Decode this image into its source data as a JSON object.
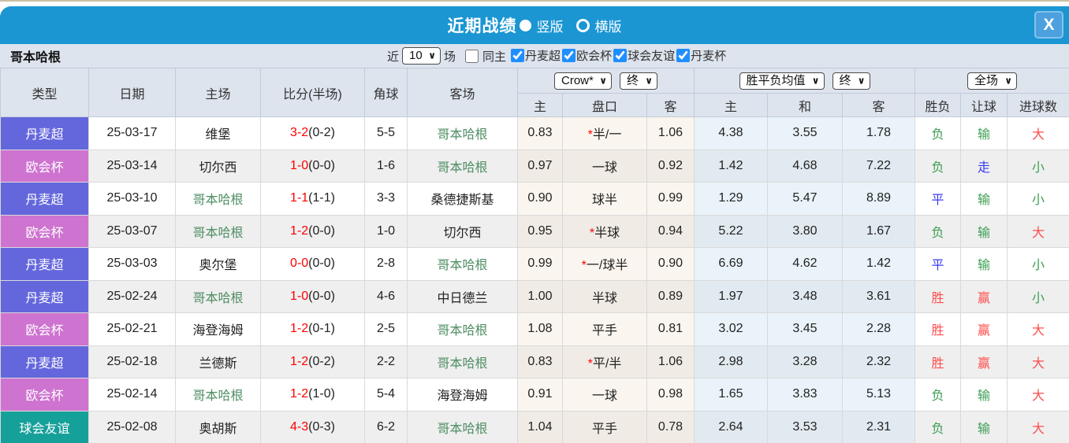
{
  "titlebar": {
    "title": "近期战绩",
    "layout_options": [
      {
        "label": "竖版",
        "selected": true
      },
      {
        "label": "横版",
        "selected": false
      }
    ],
    "close_label": "X"
  },
  "filter": {
    "team": "哥本哈根",
    "recent_label": "近",
    "recent_value": "10",
    "matches_label": "场",
    "same_home_label": "同主",
    "same_home_checked": false,
    "leagues": [
      "丹麦超",
      "欧会杯",
      "球会友谊",
      "丹麦杯"
    ]
  },
  "table": {
    "headers": {
      "main": [
        "类型",
        "日期",
        "主场",
        "比分(半场)",
        "角球",
        "客场"
      ],
      "sub": [
        "主",
        "盘口",
        "客",
        "主",
        "和",
        "客",
        "胜负",
        "让球",
        "进球数"
      ]
    },
    "selects": {
      "bookmaker": "Crow*",
      "bookmaker_period": "终",
      "avg": "胜平负均值",
      "avg_period": "终",
      "scope": "全场"
    },
    "rows": [
      {
        "league": "丹麦超",
        "date": "25-03-17",
        "home": "维堡",
        "home_self": false,
        "score_ft": "3-2",
        "score_ht": "0-2",
        "corner": "5-5",
        "away": "哥本哈根",
        "away_self": true,
        "crown_home": "0.83",
        "handicap": "半/一",
        "handicap_star": true,
        "crown_away": "1.06",
        "avg_win": "4.38",
        "avg_draw": "3.55",
        "avg_lose": "1.78",
        "wdl": {
          "text": "负",
          "color": "green"
        },
        "hcp": {
          "text": "输",
          "color": "green"
        },
        "goals": {
          "text": "大",
          "color": "red"
        }
      },
      {
        "league": "欧会杯",
        "date": "25-03-14",
        "home": "切尔西",
        "home_self": false,
        "score_ft": "1-0",
        "score_ht": "0-0",
        "corner": "1-6",
        "away": "哥本哈根",
        "away_self": true,
        "crown_home": "0.97",
        "handicap": "一球",
        "handicap_star": false,
        "crown_away": "0.92",
        "avg_win": "1.42",
        "avg_draw": "4.68",
        "avg_lose": "7.22",
        "wdl": {
          "text": "负",
          "color": "green"
        },
        "hcp": {
          "text": "走",
          "color": "blue"
        },
        "goals": {
          "text": "小",
          "color": "green"
        }
      },
      {
        "league": "丹麦超",
        "date": "25-03-10",
        "home": "哥本哈根",
        "home_self": true,
        "score_ft": "1-1",
        "score_ht": "1-1",
        "corner": "3-3",
        "away": "桑德捷斯基",
        "away_self": false,
        "crown_home": "0.90",
        "handicap": "球半",
        "handicap_star": false,
        "crown_away": "0.99",
        "avg_win": "1.29",
        "avg_draw": "5.47",
        "avg_lose": "8.89",
        "wdl": {
          "text": "平",
          "color": "blue"
        },
        "hcp": {
          "text": "输",
          "color": "green"
        },
        "goals": {
          "text": "小",
          "color": "green"
        }
      },
      {
        "league": "欧会杯",
        "date": "25-03-07",
        "home": "哥本哈根",
        "home_self": true,
        "score_ft": "1-2",
        "score_ht": "0-0",
        "corner": "1-0",
        "away": "切尔西",
        "away_self": false,
        "crown_home": "0.95",
        "handicap": "半球",
        "handicap_star": true,
        "crown_away": "0.94",
        "avg_win": "5.22",
        "avg_draw": "3.80",
        "avg_lose": "1.67",
        "wdl": {
          "text": "负",
          "color": "green"
        },
        "hcp": {
          "text": "输",
          "color": "green"
        },
        "goals": {
          "text": "大",
          "color": "red"
        }
      },
      {
        "league": "丹麦超",
        "date": "25-03-03",
        "home": "奥尔堡",
        "home_self": false,
        "score_ft": "0-0",
        "score_ht": "0-0",
        "corner": "2-8",
        "away": "哥本哈根",
        "away_self": true,
        "crown_home": "0.99",
        "handicap": "一/球半",
        "handicap_star": true,
        "crown_away": "0.90",
        "avg_win": "6.69",
        "avg_draw": "4.62",
        "avg_lose": "1.42",
        "wdl": {
          "text": "平",
          "color": "blue"
        },
        "hcp": {
          "text": "输",
          "color": "green"
        },
        "goals": {
          "text": "小",
          "color": "green"
        }
      },
      {
        "league": "丹麦超",
        "date": "25-02-24",
        "home": "哥本哈根",
        "home_self": true,
        "score_ft": "1-0",
        "score_ht": "0-0",
        "corner": "4-6",
        "away": "中日德兰",
        "away_self": false,
        "crown_home": "1.00",
        "handicap": "半球",
        "handicap_star": false,
        "crown_away": "0.89",
        "avg_win": "1.97",
        "avg_draw": "3.48",
        "avg_lose": "3.61",
        "wdl": {
          "text": "胜",
          "color": "red"
        },
        "hcp": {
          "text": "赢",
          "color": "red"
        },
        "goals": {
          "text": "小",
          "color": "green"
        }
      },
      {
        "league": "欧会杯",
        "date": "25-02-21",
        "home": "海登海姆",
        "home_self": false,
        "score_ft": "1-2",
        "score_ht": "0-1",
        "corner": "2-5",
        "away": "哥本哈根",
        "away_self": true,
        "crown_home": "1.08",
        "handicap": "平手",
        "handicap_star": false,
        "crown_away": "0.81",
        "avg_win": "3.02",
        "avg_draw": "3.45",
        "avg_lose": "2.28",
        "wdl": {
          "text": "胜",
          "color": "red"
        },
        "hcp": {
          "text": "赢",
          "color": "red"
        },
        "goals": {
          "text": "大",
          "color": "red"
        }
      },
      {
        "league": "丹麦超",
        "date": "25-02-18",
        "home": "兰德斯",
        "home_self": false,
        "score_ft": "1-2",
        "score_ht": "0-2",
        "corner": "2-2",
        "away": "哥本哈根",
        "away_self": true,
        "crown_home": "0.83",
        "handicap": "平/半",
        "handicap_star": true,
        "crown_away": "1.06",
        "avg_win": "2.98",
        "avg_draw": "3.28",
        "avg_lose": "2.32",
        "wdl": {
          "text": "胜",
          "color": "red"
        },
        "hcp": {
          "text": "赢",
          "color": "red"
        },
        "goals": {
          "text": "大",
          "color": "red"
        }
      },
      {
        "league": "欧会杯",
        "date": "25-02-14",
        "home": "哥本哈根",
        "home_self": true,
        "score_ft": "1-2",
        "score_ht": "1-0",
        "corner": "5-4",
        "away": "海登海姆",
        "away_self": false,
        "crown_home": "0.91",
        "handicap": "一球",
        "handicap_star": false,
        "crown_away": "0.98",
        "avg_win": "1.65",
        "avg_draw": "3.83",
        "avg_lose": "5.13",
        "wdl": {
          "text": "负",
          "color": "green"
        },
        "hcp": {
          "text": "输",
          "color": "green"
        },
        "goals": {
          "text": "大",
          "color": "red"
        }
      },
      {
        "league": "球会友谊",
        "date": "25-02-08",
        "home": "奥胡斯",
        "home_self": false,
        "score_ft": "4-3",
        "score_ht": "0-3",
        "corner": "6-2",
        "away": "哥本哈根",
        "away_self": true,
        "crown_home": "1.04",
        "handicap": "平手",
        "handicap_star": false,
        "crown_away": "0.78",
        "avg_win": "2.64",
        "avg_draw": "3.53",
        "avg_lose": "2.31",
        "wdl": {
          "text": "负",
          "color": "green"
        },
        "hcp": {
          "text": "输",
          "color": "green"
        },
        "goals": {
          "text": "大",
          "color": "red"
        }
      }
    ]
  },
  "theme": {
    "accent_blue": "#1b96d3",
    "checkbox_blue": "#1f8fff",
    "league_colors": {
      "丹麦超": "#6467dc",
      "欧会杯": "#ce74d0",
      "球会友谊": "#16a09a",
      "丹麦杯": "#6467dc"
    },
    "result_colors": {
      "red": "#ff4c4c",
      "green": "#3c9e53",
      "blue": "#3c3cf0"
    },
    "score_red": "#fe0000",
    "self_team_green": "#4f8e64"
  }
}
